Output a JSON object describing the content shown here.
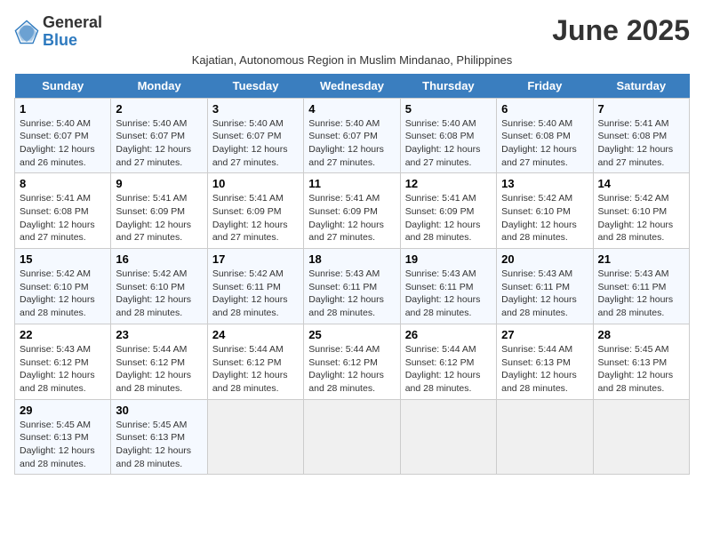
{
  "header": {
    "logo_general": "General",
    "logo_blue": "Blue",
    "month_title": "June 2025",
    "subtitle": "Kajatian, Autonomous Region in Muslim Mindanao, Philippines"
  },
  "weekdays": [
    "Sunday",
    "Monday",
    "Tuesday",
    "Wednesday",
    "Thursday",
    "Friday",
    "Saturday"
  ],
  "weeks": [
    [
      {
        "day": "1",
        "info": "Sunrise: 5:40 AM\nSunset: 6:07 PM\nDaylight: 12 hours\nand 26 minutes."
      },
      {
        "day": "2",
        "info": "Sunrise: 5:40 AM\nSunset: 6:07 PM\nDaylight: 12 hours\nand 27 minutes."
      },
      {
        "day": "3",
        "info": "Sunrise: 5:40 AM\nSunset: 6:07 PM\nDaylight: 12 hours\nand 27 minutes."
      },
      {
        "day": "4",
        "info": "Sunrise: 5:40 AM\nSunset: 6:07 PM\nDaylight: 12 hours\nand 27 minutes."
      },
      {
        "day": "5",
        "info": "Sunrise: 5:40 AM\nSunset: 6:08 PM\nDaylight: 12 hours\nand 27 minutes."
      },
      {
        "day": "6",
        "info": "Sunrise: 5:40 AM\nSunset: 6:08 PM\nDaylight: 12 hours\nand 27 minutes."
      },
      {
        "day": "7",
        "info": "Sunrise: 5:41 AM\nSunset: 6:08 PM\nDaylight: 12 hours\nand 27 minutes."
      }
    ],
    [
      {
        "day": "8",
        "info": "Sunrise: 5:41 AM\nSunset: 6:08 PM\nDaylight: 12 hours\nand 27 minutes."
      },
      {
        "day": "9",
        "info": "Sunrise: 5:41 AM\nSunset: 6:09 PM\nDaylight: 12 hours\nand 27 minutes."
      },
      {
        "day": "10",
        "info": "Sunrise: 5:41 AM\nSunset: 6:09 PM\nDaylight: 12 hours\nand 27 minutes."
      },
      {
        "day": "11",
        "info": "Sunrise: 5:41 AM\nSunset: 6:09 PM\nDaylight: 12 hours\nand 27 minutes."
      },
      {
        "day": "12",
        "info": "Sunrise: 5:41 AM\nSunset: 6:09 PM\nDaylight: 12 hours\nand 28 minutes."
      },
      {
        "day": "13",
        "info": "Sunrise: 5:42 AM\nSunset: 6:10 PM\nDaylight: 12 hours\nand 28 minutes."
      },
      {
        "day": "14",
        "info": "Sunrise: 5:42 AM\nSunset: 6:10 PM\nDaylight: 12 hours\nand 28 minutes."
      }
    ],
    [
      {
        "day": "15",
        "info": "Sunrise: 5:42 AM\nSunset: 6:10 PM\nDaylight: 12 hours\nand 28 minutes."
      },
      {
        "day": "16",
        "info": "Sunrise: 5:42 AM\nSunset: 6:10 PM\nDaylight: 12 hours\nand 28 minutes."
      },
      {
        "day": "17",
        "info": "Sunrise: 5:42 AM\nSunset: 6:11 PM\nDaylight: 12 hours\nand 28 minutes."
      },
      {
        "day": "18",
        "info": "Sunrise: 5:43 AM\nSunset: 6:11 PM\nDaylight: 12 hours\nand 28 minutes."
      },
      {
        "day": "19",
        "info": "Sunrise: 5:43 AM\nSunset: 6:11 PM\nDaylight: 12 hours\nand 28 minutes."
      },
      {
        "day": "20",
        "info": "Sunrise: 5:43 AM\nSunset: 6:11 PM\nDaylight: 12 hours\nand 28 minutes."
      },
      {
        "day": "21",
        "info": "Sunrise: 5:43 AM\nSunset: 6:11 PM\nDaylight: 12 hours\nand 28 minutes."
      }
    ],
    [
      {
        "day": "22",
        "info": "Sunrise: 5:43 AM\nSunset: 6:12 PM\nDaylight: 12 hours\nand 28 minutes."
      },
      {
        "day": "23",
        "info": "Sunrise: 5:44 AM\nSunset: 6:12 PM\nDaylight: 12 hours\nand 28 minutes."
      },
      {
        "day": "24",
        "info": "Sunrise: 5:44 AM\nSunset: 6:12 PM\nDaylight: 12 hours\nand 28 minutes."
      },
      {
        "day": "25",
        "info": "Sunrise: 5:44 AM\nSunset: 6:12 PM\nDaylight: 12 hours\nand 28 minutes."
      },
      {
        "day": "26",
        "info": "Sunrise: 5:44 AM\nSunset: 6:12 PM\nDaylight: 12 hours\nand 28 minutes."
      },
      {
        "day": "27",
        "info": "Sunrise: 5:44 AM\nSunset: 6:13 PM\nDaylight: 12 hours\nand 28 minutes."
      },
      {
        "day": "28",
        "info": "Sunrise: 5:45 AM\nSunset: 6:13 PM\nDaylight: 12 hours\nand 28 minutes."
      }
    ],
    [
      {
        "day": "29",
        "info": "Sunrise: 5:45 AM\nSunset: 6:13 PM\nDaylight: 12 hours\nand 28 minutes."
      },
      {
        "day": "30",
        "info": "Sunrise: 5:45 AM\nSunset: 6:13 PM\nDaylight: 12 hours\nand 28 minutes."
      },
      null,
      null,
      null,
      null,
      null
    ]
  ]
}
